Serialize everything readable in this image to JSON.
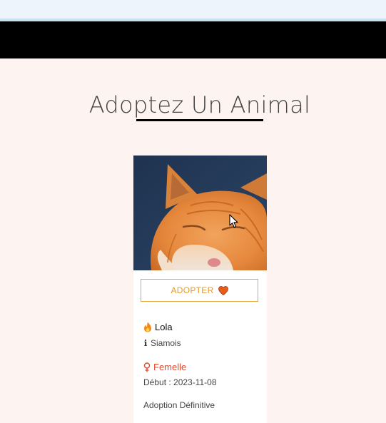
{
  "page": {
    "title": "Adoptez Un Animal"
  },
  "card": {
    "image_icon": "sleeping-orange-cat-photo",
    "adopt_label": "ADOPTER",
    "adopt_icon": "heart-icon",
    "name": "Lola",
    "name_icon": "fire-icon",
    "breed": "Siamois",
    "breed_icon": "info-icon",
    "gender": "Femelle",
    "gender_icon": "female-icon",
    "start": "Début : 2023-11-08",
    "adoption_type": "Adoption Définitive"
  },
  "colors": {
    "page_background": "#fdf4f1",
    "header": "#000000",
    "accent": "#e9a73c",
    "heart": "#e85d1a",
    "gender": "#e8472c"
  }
}
